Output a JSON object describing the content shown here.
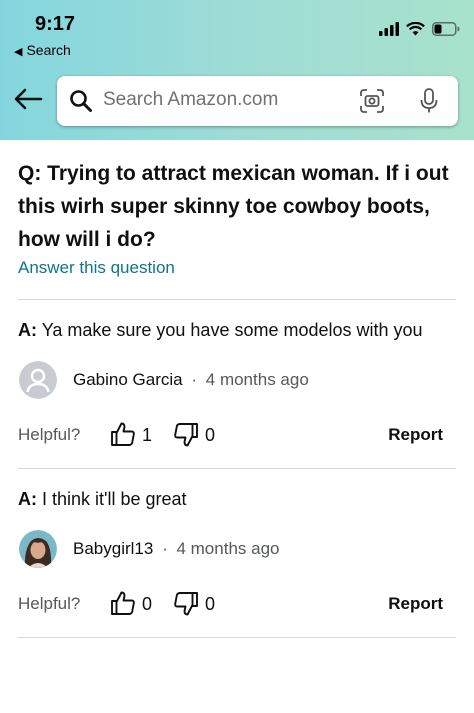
{
  "status_bar": {
    "time": "9:17",
    "back_label": "Search",
    "icons": [
      "signal-icon",
      "wifi-icon",
      "battery-icon"
    ]
  },
  "search": {
    "placeholder": "Search Amazon.com",
    "value": ""
  },
  "question": {
    "text": "Q: Trying to attract mexican woman. If i out this wirh super skinny toe cowboy boots, how will i do?",
    "answer_link": "Answer this question"
  },
  "answers": [
    {
      "prefix": "A:",
      "text": "Ya make sure you have some modelos with you",
      "author": "Gabino Garcia",
      "separator": "·",
      "time_ago": "4 months ago",
      "helpful_label": "Helpful?",
      "up_votes": "1",
      "down_votes": "0",
      "report_label": "Report"
    },
    {
      "prefix": "A:",
      "text": "I think it'll be great",
      "author": "Babygirl13",
      "separator": "·",
      "time_ago": "4 months ago",
      "helpful_label": "Helpful?",
      "up_votes": "0",
      "down_votes": "0",
      "report_label": "Report"
    }
  ],
  "colors": {
    "link": "#137486",
    "header_gradient_start": "#84d6de",
    "header_gradient_end": "#a8e2cc",
    "divider": "#d5d9d9"
  }
}
